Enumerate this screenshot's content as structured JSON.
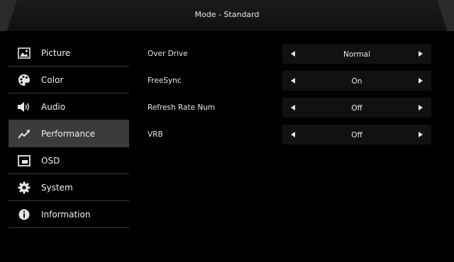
{
  "header": {
    "title": "Mode - Standard"
  },
  "sidebar": {
    "items": [
      {
        "label": "Picture",
        "icon": "picture-icon",
        "active": false
      },
      {
        "label": "Color",
        "icon": "palette-icon",
        "active": false
      },
      {
        "label": "Audio",
        "icon": "speaker-icon",
        "active": false
      },
      {
        "label": "Performance",
        "icon": "trend-up-icon",
        "active": true
      },
      {
        "label": "OSD",
        "icon": "osd-window-icon",
        "active": false
      },
      {
        "label": "System",
        "icon": "gear-icon",
        "active": false
      },
      {
        "label": "Information",
        "icon": "info-icon",
        "active": false
      }
    ]
  },
  "settings": {
    "rows": [
      {
        "label": "Over Drive",
        "value": "Normal"
      },
      {
        "label": "FreeSync",
        "value": "On"
      },
      {
        "label": "Refresh Rate Num",
        "value": "Off"
      },
      {
        "label": "VRB",
        "value": "Off"
      }
    ]
  },
  "colors": {
    "active_bg": "#3b3b3b",
    "panel_bg": "#000000",
    "text": "#e8e8e8"
  }
}
